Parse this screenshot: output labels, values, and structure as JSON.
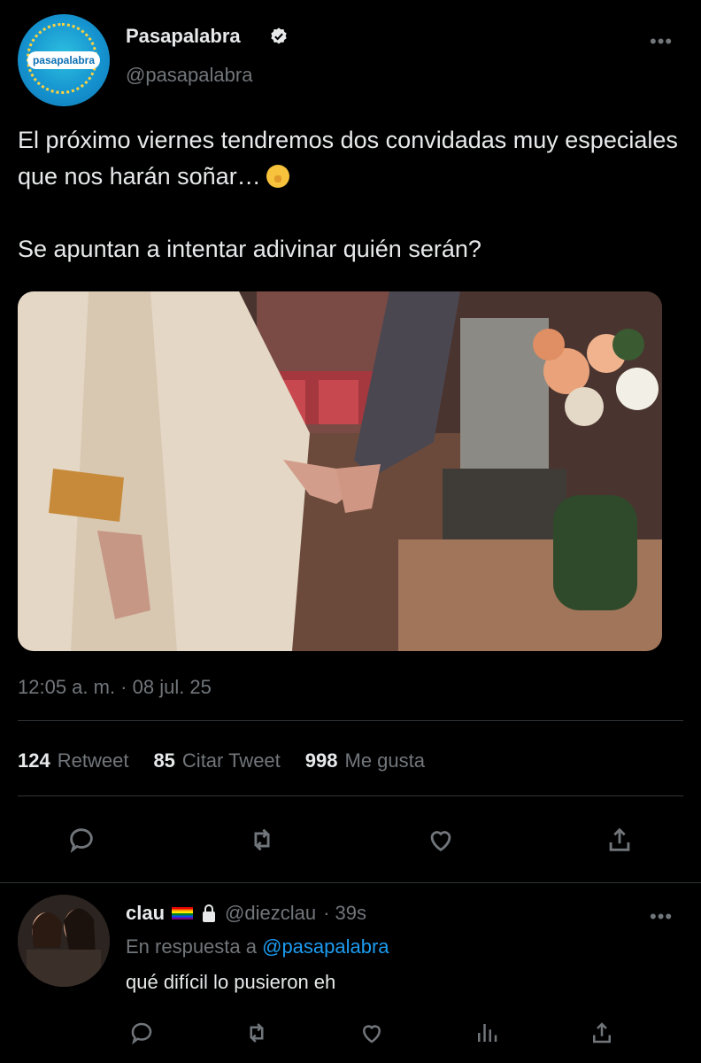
{
  "tweet": {
    "author_name": "Pasapalabra",
    "author_handle": "@pasapalabra",
    "avatar_brand": "pasapalabra",
    "more_label": "•••",
    "text_line1": "El próximo viernes tendremos dos convidadas muy especiales que nos harán soñar…",
    "text_line2": "Se apuntan a intentar adivinar quién serán?",
    "emoji": "shushing-face",
    "timestamp": "12:05 a. m. · 08 jul. 25",
    "stats": {
      "retweets_count": "124",
      "retweets_label": "Retweet",
      "quotes_count": "85",
      "quotes_label": "Citar Tweet",
      "likes_count": "998",
      "likes_label": "Me gusta"
    },
    "actions": [
      "reply-icon",
      "retweet-icon",
      "like-icon",
      "share-icon"
    ]
  },
  "reply": {
    "name": "clau",
    "handle": "@diezclau",
    "time": "· 39s",
    "more_label": "•••",
    "in_reply_prefix": "En respuesta a",
    "in_reply_mention": "@pasapalabra",
    "text": "qué difícil lo pusieron eh",
    "actions": [
      "reply-icon",
      "retweet-icon",
      "like-icon",
      "views-icon",
      "share-icon"
    ]
  },
  "colors": {
    "background": "#000000",
    "text": "#e7e9ea",
    "muted": "#71767b",
    "link": "#1d9bf0",
    "verified": "#e7e9ea"
  }
}
